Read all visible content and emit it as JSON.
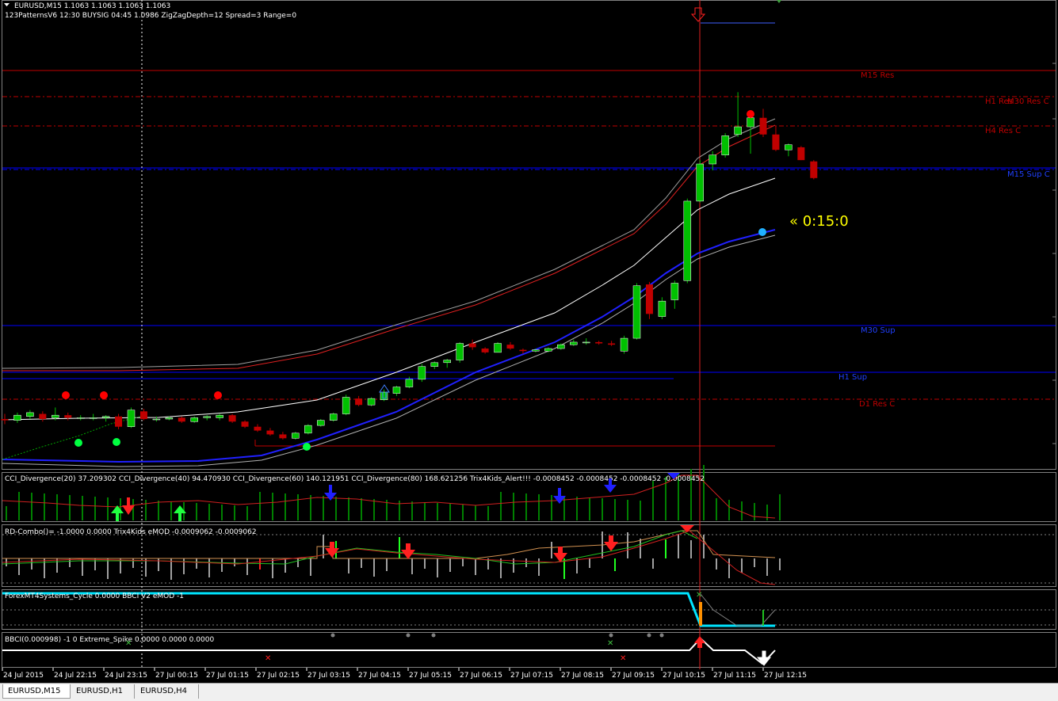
{
  "main_header": {
    "symbol": "EURUSD,M15  1.1063 1.1063 1.1063 1.1063",
    "indicators": "123PatternsV6  12:30  BUYSIG  04:45  1.0986  ZigZagDepth=12  Spread=3  Range=0"
  },
  "levels": {
    "m15_res": "M15 Res",
    "h1_res": "H1 Res",
    "m30_res_c": "M30 Res C",
    "h4_res_c": "H4 Res C",
    "m15_sup_c": "M15 Sup C",
    "m30_sup": "M30 Sup",
    "h1_sup": "H1 Sup",
    "d1_res_c": "D1 Res C"
  },
  "timer": "« 0:15:0",
  "panes": {
    "cci": "CCI_Divergence(20) 37.209302  CCI_Divergence(40) 94.470930  CCI_Divergence(60) 140.121951  CCI_Divergence(80) 168.621256  Trix4Kids_Alert!!! -0.0008452 -0.0008452 -0.0008452 -0.0008452",
    "rd": "RD-Combo()= -1.0000 0.0000  Trix4Kids eMOD -0.0009062 -0.0009062",
    "cycle": "ForexMT4Systems_Cycle 0.0000  BBCI V2 eMOD -1",
    "bbci": "BBCI(0.000998) -1 0  Extreme_Spike 0.0000 0.0000 0.0000"
  },
  "time_axis": [
    "24 Jul 2015",
    "24 Jul 22:15",
    "24 Jul 23:15",
    "27 Jul 00:15",
    "27 Jul 01:15",
    "27 Jul 02:15",
    "27 Jul 03:15",
    "27 Jul 04:15",
    "27 Jul 05:15",
    "27 Jul 06:15",
    "27 Jul 07:15",
    "27 Jul 08:15",
    "27 Jul 09:15",
    "27 Jul 10:15",
    "27 Jul 11:15",
    "27 Jul 12:15"
  ],
  "tabs": [
    "EURUSD,M15",
    "EURUSD,H1",
    "EURUSD,H4"
  ],
  "colors": {
    "bull": "#00c000",
    "bear": "#c00000",
    "resistance": "#c00000",
    "support": "#0000ff",
    "timer": "#ffff00",
    "cycle": "#00e5ff"
  },
  "chart_data": {
    "type": "candlestick",
    "candles": [
      {
        "o": 1.0986,
        "h": 1.099,
        "l": 1.0982,
        "c": 1.0985
      },
      {
        "o": 1.0985,
        "h": 1.0991,
        "l": 1.0983,
        "c": 1.0989
      },
      {
        "o": 1.0988,
        "h": 1.0993,
        "l": 1.0986,
        "c": 1.0991
      },
      {
        "o": 1.099,
        "h": 1.0992,
        "l": 1.0984,
        "c": 1.0986
      },
      {
        "o": 1.0987,
        "h": 1.0995,
        "l": 1.0985,
        "c": 1.0989
      },
      {
        "o": 1.0989,
        "h": 1.0991,
        "l": 1.0985,
        "c": 1.0987
      },
      {
        "o": 1.0987,
        "h": 1.0989,
        "l": 1.0985,
        "c": 1.0987
      },
      {
        "o": 1.0987,
        "h": 1.099,
        "l": 1.0985,
        "c": 1.0987
      },
      {
        "o": 1.0987,
        "h": 1.0989,
        "l": 1.0984,
        "c": 1.0988
      },
      {
        "o": 1.0988,
        "h": 1.099,
        "l": 1.0978,
        "c": 1.098
      },
      {
        "o": 1.098,
        "h": 1.0995,
        "l": 1.0979,
        "c": 1.0993
      },
      {
        "o": 1.0992,
        "h": 1.0994,
        "l": 1.0985,
        "c": 1.0986
      },
      {
        "o": 1.0986,
        "h": 1.0988,
        "l": 1.0984,
        "c": 1.0986
      },
      {
        "o": 1.0986,
        "h": 1.0988,
        "l": 1.0985,
        "c": 1.0987
      },
      {
        "o": 1.0987,
        "h": 1.0988,
        "l": 1.0983,
        "c": 1.0984
      },
      {
        "o": 1.0984,
        "h": 1.0988,
        "l": 1.0983,
        "c": 1.0987
      },
      {
        "o": 1.0987,
        "h": 1.0989,
        "l": 1.0985,
        "c": 1.0988
      },
      {
        "o": 1.0987,
        "h": 1.099,
        "l": 1.0985,
        "c": 1.0989
      },
      {
        "o": 1.0989,
        "h": 1.099,
        "l": 1.0983,
        "c": 1.0984
      },
      {
        "o": 1.0984,
        "h": 1.0985,
        "l": 1.0979,
        "c": 1.098
      },
      {
        "o": 1.098,
        "h": 1.0982,
        "l": 1.0976,
        "c": 1.0977
      },
      {
        "o": 1.0977,
        "h": 1.0979,
        "l": 1.0973,
        "c": 1.0974
      },
      {
        "o": 1.0974,
        "h": 1.0976,
        "l": 1.097,
        "c": 1.0971
      },
      {
        "o": 1.0971,
        "h": 1.0976,
        "l": 1.097,
        "c": 1.0975
      },
      {
        "o": 1.0975,
        "h": 1.0982,
        "l": 1.0974,
        "c": 1.0981
      },
      {
        "o": 1.0981,
        "h": 1.0986,
        "l": 1.098,
        "c": 1.0985
      },
      {
        "o": 1.0985,
        "h": 1.0991,
        "l": 1.0984,
        "c": 1.099
      },
      {
        "o": 1.099,
        "h": 1.1005,
        "l": 1.0989,
        "c": 1.1003
      },
      {
        "o": 1.1002,
        "h": 1.1004,
        "l": 1.0996,
        "c": 1.0997
      },
      {
        "o": 1.0997,
        "h": 1.1003,
        "l": 1.0996,
        "c": 1.1002
      },
      {
        "o": 1.1001,
        "h": 1.1009,
        "l": 1.1,
        "c": 1.1007
      },
      {
        "o": 1.1006,
        "h": 1.1012,
        "l": 1.1004,
        "c": 1.1011
      },
      {
        "o": 1.1011,
        "h": 1.1019,
        "l": 1.101,
        "c": 1.1017
      },
      {
        "o": 1.1017,
        "h": 1.1029,
        "l": 1.1015,
        "c": 1.1027
      },
      {
        "o": 1.1027,
        "h": 1.1031,
        "l": 1.1025,
        "c": 1.103
      },
      {
        "o": 1.103,
        "h": 1.1033,
        "l": 1.1026,
        "c": 1.1032
      },
      {
        "o": 1.1032,
        "h": 1.1046,
        "l": 1.103,
        "c": 1.1045
      },
      {
        "o": 1.1045,
        "h": 1.1048,
        "l": 1.104,
        "c": 1.1042
      },
      {
        "o": 1.1041,
        "h": 1.1042,
        "l": 1.1037,
        "c": 1.1038
      },
      {
        "o": 1.1038,
        "h": 1.1046,
        "l": 1.1038,
        "c": 1.1045
      },
      {
        "o": 1.1044,
        "h": 1.1046,
        "l": 1.104,
        "c": 1.1041
      },
      {
        "o": 1.104,
        "h": 1.1041,
        "l": 1.1037,
        "c": 1.1039
      },
      {
        "o": 1.1039,
        "h": 1.1041,
        "l": 1.1038,
        "c": 1.104
      },
      {
        "o": 1.1039,
        "h": 1.1042,
        "l": 1.1038,
        "c": 1.1041
      },
      {
        "o": 1.1041,
        "h": 1.1045,
        "l": 1.104,
        "c": 1.1044
      },
      {
        "o": 1.1044,
        "h": 1.1048,
        "l": 1.1043,
        "c": 1.1046
      },
      {
        "o": 1.1046,
        "h": 1.1049,
        "l": 1.1044,
        "c": 1.1046
      },
      {
        "o": 1.1046,
        "h": 1.1047,
        "l": 1.1044,
        "c": 1.1045
      },
      {
        "o": 1.1045,
        "h": 1.1047,
        "l": 1.1043,
        "c": 1.1044
      },
      {
        "o": 1.1039,
        "h": 1.1051,
        "l": 1.1037,
        "c": 1.1049
      },
      {
        "o": 1.1049,
        "h": 1.1092,
        "l": 1.1048,
        "c": 1.109
      },
      {
        "o": 1.1091,
        "h": 1.1093,
        "l": 1.1064,
        "c": 1.1068
      },
      {
        "o": 1.1066,
        "h": 1.1081,
        "l": 1.1064,
        "c": 1.1078
      },
      {
        "o": 1.1079,
        "h": 1.1094,
        "l": 1.1072,
        "c": 1.1092
      },
      {
        "o": 1.1094,
        "h": 1.1158,
        "l": 1.1092,
        "c": 1.1156
      },
      {
        "o": 1.1156,
        "h": 1.1188,
        "l": 1.1155,
        "c": 1.1185
      },
      {
        "o": 1.1185,
        "h": 1.1195,
        "l": 1.118,
        "c": 1.1192
      },
      {
        "o": 1.1192,
        "h": 1.1209,
        "l": 1.119,
        "c": 1.1207
      },
      {
        "o": 1.1208,
        "h": 1.1241,
        "l": 1.1206,
        "c": 1.1214
      },
      {
        "o": 1.1214,
        "h": 1.1225,
        "l": 1.1193,
        "c": 1.1221
      },
      {
        "o": 1.1221,
        "h": 1.1228,
        "l": 1.1206,
        "c": 1.1208
      },
      {
        "o": 1.1208,
        "h": 1.1215,
        "l": 1.1195,
        "c": 1.1196
      },
      {
        "o": 1.1196,
        "h": 1.1201,
        "l": 1.1191,
        "c": 1.12
      },
      {
        "o": 1.1198,
        "h": 1.1199,
        "l": 1.1188,
        "c": 1.1188
      },
      {
        "o": 1.1187,
        "h": 1.1188,
        "l": 1.1173,
        "c": 1.1174
      }
    ]
  }
}
